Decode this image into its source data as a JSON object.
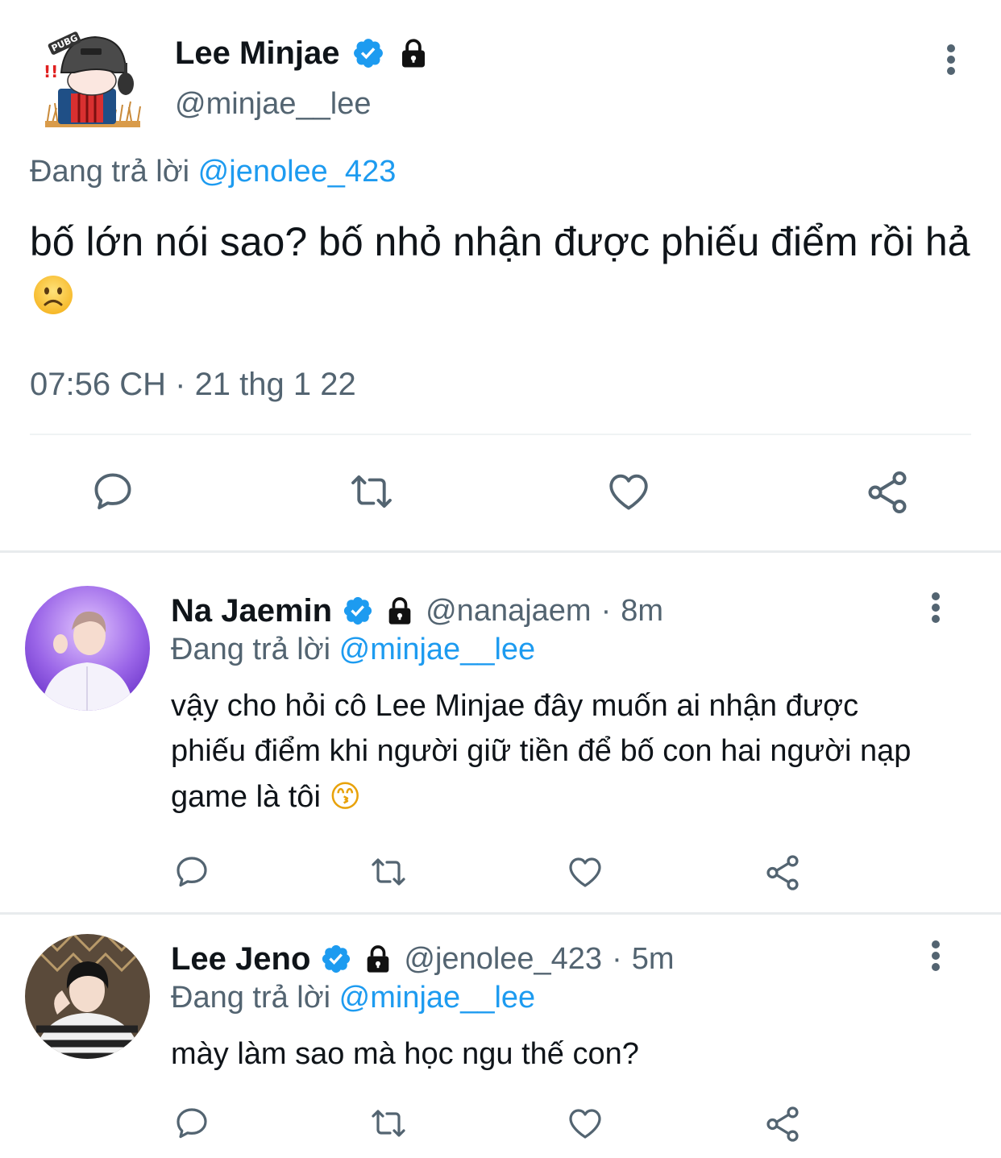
{
  "main_tweet": {
    "display_name": "Lee Minjae",
    "handle": "@minjae__lee",
    "avatar_badge": "PUBG",
    "reply_prefix": "Đang trả lời",
    "reply_to": "@jenolee_423",
    "text": "bố lớn nói sao? bố nhỏ nhận được phiếu điểm rồi hả",
    "emoji": "☹",
    "time": "07:56 CH",
    "separator": "·",
    "date": "21 thg 1 22"
  },
  "replies": [
    {
      "display_name": "Na Jaemin",
      "handle": "@nanajaem",
      "age": "8m",
      "separator": "·",
      "reply_prefix": "Đang trả lời",
      "reply_to": "@minjae__lee",
      "text": "vậy cho hỏi cô Lee Minjae đây muốn ai nhận được phiếu điểm khi người giữ tiền để bố con hai người nạp game là tôi",
      "emoji": "😙"
    },
    {
      "display_name": "Lee Jeno",
      "handle": "@jenolee_423",
      "age": "5m",
      "separator": "·",
      "reply_prefix": "Đang trả lời",
      "reply_to": "@minjae__lee",
      "text": "mày làm sao mà học ngu thế con?",
      "emoji": ""
    }
  ],
  "icons": {
    "verified": "verified-badge-icon",
    "protected": "lock-icon",
    "more": "more-vertical-icon",
    "reply": "comment-icon",
    "retweet": "retweet-icon",
    "like": "heart-icon",
    "share": "share-icon"
  },
  "colors": {
    "accent": "#1d9bf0",
    "secondary_text": "#536471",
    "icon": "#536471"
  }
}
